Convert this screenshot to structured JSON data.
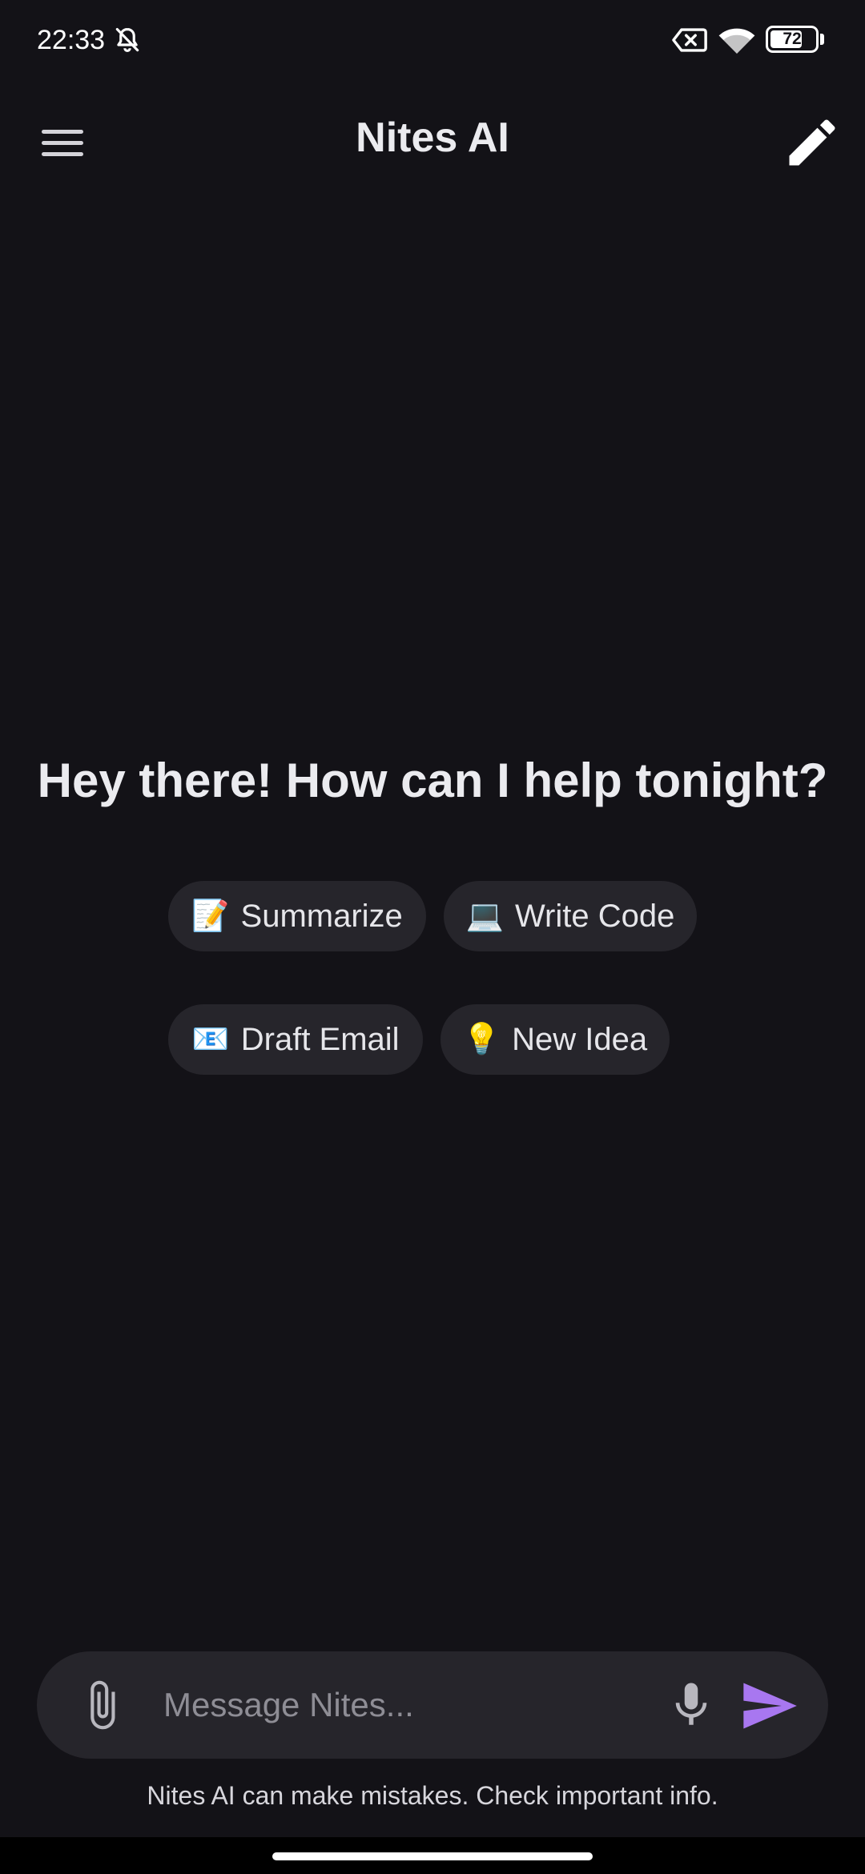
{
  "status_bar": {
    "time": "22:33",
    "battery_level": "72",
    "battery_fraction": 0.72,
    "icons": [
      "bell-off-icon",
      "sim-disabled-icon",
      "wifi-icon",
      "battery-icon"
    ]
  },
  "header": {
    "title": "Nites AI",
    "menu_icon": "hamburger-menu-icon",
    "new_chat_icon": "pencil-icon"
  },
  "main": {
    "greeting": "Hey there! How can I help tonight?",
    "suggestions": [
      {
        "emoji": "📝",
        "label": "Summarize"
      },
      {
        "emoji": "💻",
        "label": "Write Code"
      },
      {
        "emoji": "📧",
        "label": "Draft Email"
      },
      {
        "emoji": "💡",
        "label": "New Idea"
      }
    ]
  },
  "composer": {
    "placeholder": "Message Nites...",
    "value": "",
    "attach_icon": "paperclip-icon",
    "mic_icon": "microphone-icon",
    "send_icon": "send-icon"
  },
  "footer": {
    "disclaimer": "Nites AI can make mistakes. Check important info."
  },
  "colors": {
    "background": "#131217",
    "surface": "#26252b",
    "accent": "#a877f0",
    "text": "#ebebef",
    "placeholder": "#8e8d95"
  }
}
